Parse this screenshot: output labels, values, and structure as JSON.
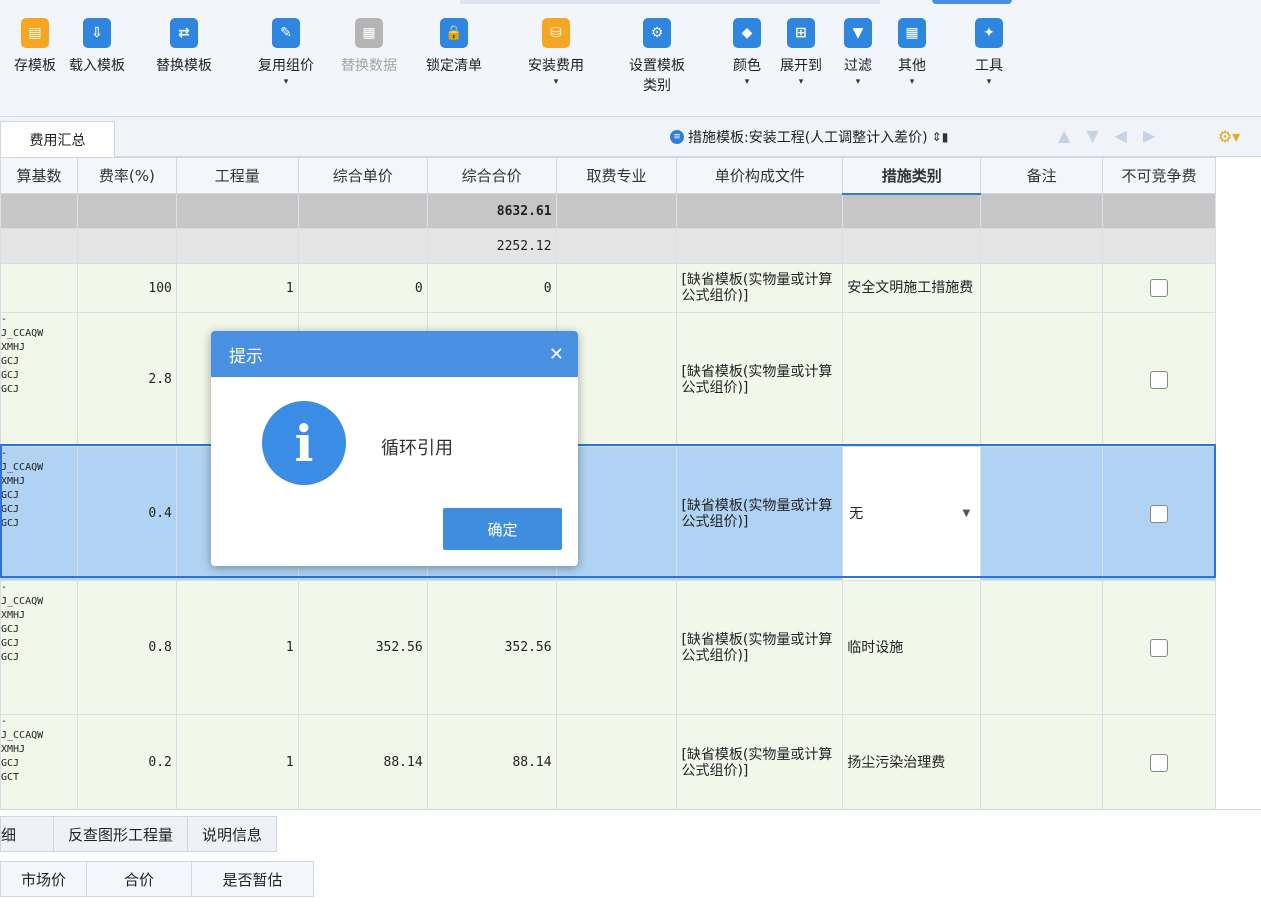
{
  "toolbar": {
    "items": [
      {
        "label": "存模板",
        "color": "#f5a623",
        "caret": false
      },
      {
        "label": "载入模板",
        "color": "#2e86de",
        "caret": false
      },
      {
        "label": "替换模板",
        "color": "#2e86de",
        "caret": false
      },
      {
        "label": "复用组价",
        "color": "#2e86de",
        "caret": true
      },
      {
        "label": "替换数据",
        "color": "#b5b5b5",
        "caret": false,
        "disabled": true
      },
      {
        "label": "锁定清单",
        "color": "#2e86de",
        "caret": false
      },
      {
        "label": "安装费用",
        "color": "#f5a623",
        "caret": true
      },
      {
        "label": "设置模板类别",
        "color": "#2e86de",
        "caret": false
      },
      {
        "label": "颜色",
        "color": "#2e86de",
        "caret": true
      },
      {
        "label": "展开到",
        "color": "#2e86de",
        "caret": true
      },
      {
        "label": "过滤",
        "color": "#2e86de",
        "caret": true
      },
      {
        "label": "其他",
        "color": "#2e86de",
        "caret": true
      },
      {
        "label": "工具",
        "color": "#2e86de",
        "caret": true
      }
    ]
  },
  "tabbar": {
    "active_tab": "费用汇总",
    "template_label": "措施模板:安装工程(人工调整计入差价)"
  },
  "grid": {
    "headers": [
      "算基数",
      "费率(%)",
      "工程量",
      "综合单价",
      "综合合价",
      "取费专业",
      "单价构成文件",
      "措施类别",
      "备注",
      "不可竞争费"
    ],
    "rows": [
      {
        "kind": "sum",
        "base": "",
        "rate": "",
        "qty": "",
        "price": "",
        "total": "8632.61",
        "major": "",
        "file": "",
        "category": "",
        "note": ""
      },
      {
        "kind": "sub",
        "base": "",
        "rate": "",
        "qty": "",
        "price": "",
        "total": "2252.12",
        "major": "",
        "file": "",
        "category": "",
        "note": ""
      },
      {
        "kind": "normal",
        "base": "",
        "rate": "100",
        "qty": "1",
        "price": "0",
        "total": "0",
        "major": "",
        "file": "[缺省模板(实物量或计算公式组价)]",
        "category": "安全文明施工措施费",
        "note": ""
      },
      {
        "kind": "normal",
        "base": "-\nJ_CCAQW\nXMHJ\nGCJ\nGCJ\nGCJ",
        "rate": "2.8",
        "qty": "",
        "price": "",
        "total": "",
        "major": "",
        "file": "[缺省模板(实物量或计算公式组价)]",
        "category": "",
        "note": ""
      },
      {
        "kind": "sel",
        "base": "-\nJ_CCAQW\nXMHJ\nGCJ\nGCJ\nGCJ",
        "rate": "0.4",
        "qty": "",
        "price": "",
        "total": "",
        "major": "",
        "file": "[缺省模板(实物量或计算公式组价)]",
        "category": "无",
        "note": ""
      },
      {
        "kind": "normal",
        "base": "-\nJ_CCAQW\nXMHJ\nGCJ\nGCJ\nGCJ",
        "rate": "0.8",
        "qty": "1",
        "price": "352.56",
        "total": "352.56",
        "major": "",
        "file": "[缺省模板(实物量或计算公式组价)]",
        "category": "临时设施",
        "note": ""
      },
      {
        "kind": "normal",
        "base": "-\nJ_CCAQW\nXMHJ\nGCJ\nGCT",
        "rate": "0.2",
        "qty": "1",
        "price": "88.14",
        "total": "88.14",
        "major": "",
        "file": "[缺省模板(实物量或计算公式组价)]",
        "category": "扬尘污染治理费",
        "note": ""
      }
    ]
  },
  "bottom": {
    "tabs": [
      "细",
      "反查图形工程量",
      "说明信息"
    ],
    "columns": [
      "市场价",
      "合价",
      "是否暂估"
    ]
  },
  "dialog": {
    "title": "提示",
    "message": "循环引用",
    "ok_label": "确定"
  }
}
